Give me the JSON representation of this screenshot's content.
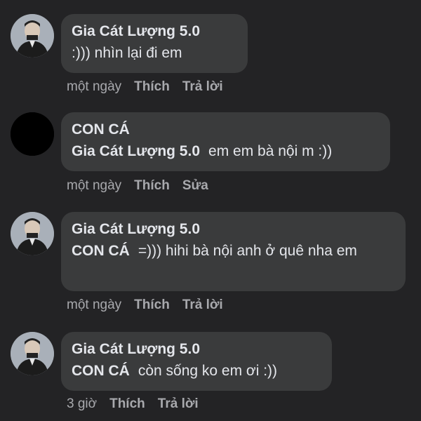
{
  "comments": [
    {
      "author": "Gia Cát Lượng 5.0",
      "avatar": "man-in-suit-avatar",
      "mention": "",
      "text": ":))) nhìn lại đi em",
      "time": "một ngày",
      "like": "Thích",
      "second_action": "Trả lời"
    },
    {
      "author": "CON CÁ",
      "avatar": "black-avatar",
      "mention": "Gia Cát Lượng 5.0",
      "text": "em em bà nội m :))",
      "time": "một ngày",
      "like": "Thích",
      "second_action": "Sửa"
    },
    {
      "author": "Gia Cát Lượng 5.0",
      "avatar": "man-in-suit-avatar",
      "mention": "CON CÁ",
      "text": "=))) hihi bà nội anh ở quê nha em",
      "time": "một ngày",
      "like": "Thích",
      "second_action": "Trả lời"
    },
    {
      "author": "Gia Cát Lượng 5.0",
      "avatar": "man-in-suit-avatar",
      "mention": "CON CÁ",
      "text": "còn sống ko em ơi :))",
      "time": "3 giờ",
      "like": "Thích",
      "second_action": "Trả lời"
    }
  ],
  "colors": {
    "background": "#232325",
    "bubble": "#3a3b3c",
    "text": "#e4e6eb",
    "secondary_text": "#a8a9ad"
  }
}
